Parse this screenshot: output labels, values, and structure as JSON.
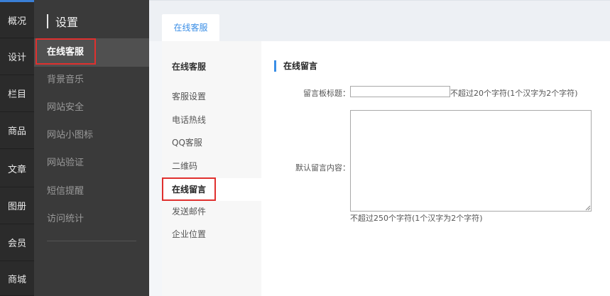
{
  "rail": {
    "items": [
      {
        "label": "概况"
      },
      {
        "label": "设计"
      },
      {
        "label": "栏目"
      },
      {
        "label": "商品"
      },
      {
        "label": "文章"
      },
      {
        "label": "图册"
      },
      {
        "label": "会员"
      },
      {
        "label": "商城"
      }
    ]
  },
  "sidebar": {
    "title": "设置",
    "items": [
      {
        "label": "在线客服"
      },
      {
        "label": "背景音乐"
      },
      {
        "label": "网站安全"
      },
      {
        "label": "网站小图标"
      },
      {
        "label": "网站验证"
      },
      {
        "label": "短信提醒"
      },
      {
        "label": "访问统计"
      }
    ]
  },
  "tabs": [
    {
      "label": "在线客服"
    }
  ],
  "subnav": {
    "header": "在线客服",
    "items": [
      {
        "label": "客服设置"
      },
      {
        "label": "电话热线"
      },
      {
        "label": "QQ客服"
      },
      {
        "label": "二维码"
      },
      {
        "label": "在线留言"
      },
      {
        "label": "发送邮件"
      },
      {
        "label": "企业位置"
      }
    ]
  },
  "form": {
    "section_title": "在线留言",
    "title_label": "留言板标题：",
    "title_value": "",
    "title_hint": "不超过20个字符(1个汉字为2个字符)",
    "content_label": "默认留言内容：",
    "content_value": "",
    "content_hint": "不超过250个字符(1个汉字为2个字符)"
  },
  "colors": {
    "accent": "#3a8ee6",
    "highlight": "#e0302e",
    "rail_bg": "#2b2b2b",
    "sidebar_bg": "#3a3a3a"
  }
}
